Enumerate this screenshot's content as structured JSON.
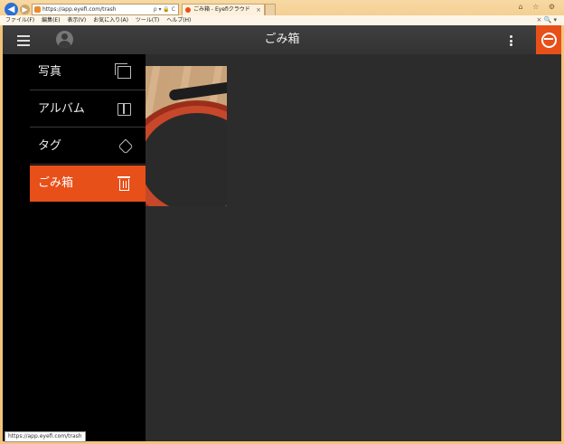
{
  "browser": {
    "url": "https://app.eyefi.com/trash",
    "tab_title": "ごみ箱 - Eyefiクラウド",
    "tab_close": "×",
    "address_tools": "ρ ▾ 🔒 C",
    "window_buttons": "⌂ ☆ ⚙",
    "menu": [
      "ファイル(F)",
      "編集(E)",
      "表示(V)",
      "お気に入り(A)",
      "ツール(T)",
      "ヘルプ(H)"
    ],
    "menu_right": "× 🔍 ▾",
    "status_url": "https://app.eyefi.com/trash"
  },
  "app": {
    "page_title": "ごみ箱",
    "accent_color": "#e8501a"
  },
  "drawer": {
    "items": [
      {
        "label": "写真",
        "icon": "photos-icon"
      },
      {
        "label": "アルバム",
        "icon": "album-icon"
      },
      {
        "label": "タグ",
        "icon": "tag-icon"
      },
      {
        "label": "ごみ箱",
        "icon": "trash-icon",
        "active": true
      }
    ]
  }
}
